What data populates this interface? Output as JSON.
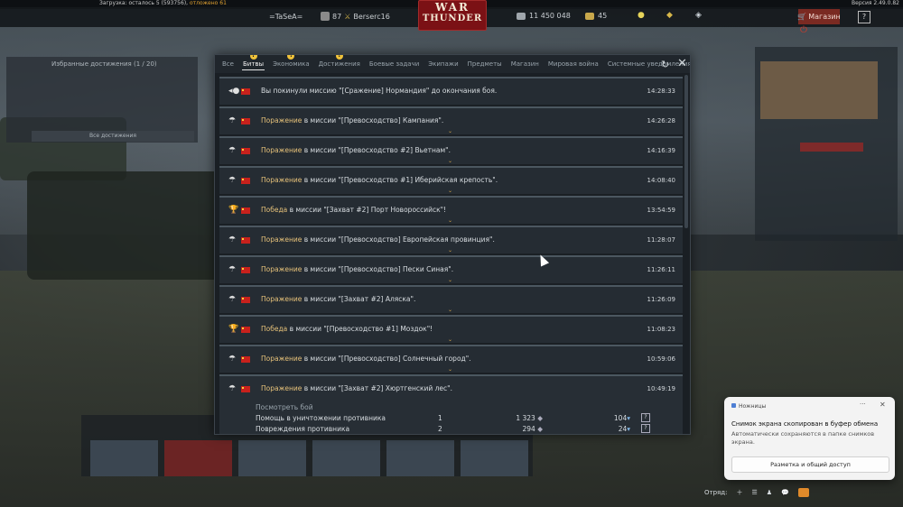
{
  "topbar": {
    "load_label": "Загрузка: осталось 5 (593756),",
    "load_warn": "отложено 61",
    "version": "Версия 2.49.0.82"
  },
  "header": {
    "clan": "=TaSeA=",
    "player_level": "87",
    "player_name": "Berserc16",
    "logo_line1": "WAR",
    "logo_line2": "THUNDER",
    "silver": "11 450 048",
    "gold": "45",
    "shop_label": "Магазин",
    "help_label": "?"
  },
  "bg_panels": {
    "left_title": "Избранные достижения (1 / 20)",
    "left_button": "Все достижения"
  },
  "notifications": {
    "tabs": [
      {
        "label": "Все",
        "badge": ""
      },
      {
        "label": "Битвы",
        "badge": "!"
      },
      {
        "label": "Экономика",
        "badge": "!"
      },
      {
        "label": "Достижения",
        "badge": "!"
      },
      {
        "label": "Боевые задачи",
        "badge": ""
      },
      {
        "label": "Экипажи",
        "badge": ""
      },
      {
        "label": "Предметы",
        "badge": ""
      },
      {
        "label": "Магазин",
        "badge": ""
      },
      {
        "label": "Мировая война",
        "badge": ""
      },
      {
        "label": "Системные уведомления",
        "badge": ""
      }
    ],
    "active_tab": "Битвы",
    "rows": [
      {
        "icon": "leave-icon",
        "result": "",
        "text": "Вы покинули миссию \"[Сражение] Нормандия\" до окончания боя.",
        "time": "14:28:33"
      },
      {
        "icon": "parachute-icon",
        "result": "Поражение",
        "text": " в миссии \"[Превосходство] Кампания\".",
        "time": "14:26:28"
      },
      {
        "icon": "parachute-icon",
        "result": "Поражение",
        "text": " в миссии \"[Превосходство #2] Вьетнам\".",
        "time": "14:16:39"
      },
      {
        "icon": "parachute-icon",
        "result": "Поражение",
        "text": " в миссии \"[Превосходство #1] Иберийская крепость\".",
        "time": "14:08:40"
      },
      {
        "icon": "trophy-icon",
        "result": "Победа",
        "text": " в миссии \"[Захват #2] Порт Новороссийск\"!",
        "time": "13:54:59"
      },
      {
        "icon": "parachute-icon",
        "result": "Поражение",
        "text": " в миссии \"[Превосходство] Европейская провинция\".",
        "time": "11:28:07"
      },
      {
        "icon": "parachute-icon",
        "result": "Поражение",
        "text": " в миссии \"[Превосходство] Пески Синая\".",
        "time": "11:26:11"
      },
      {
        "icon": "parachute-icon",
        "result": "Поражение",
        "text": " в миссии \"[Захват #2] Аляска\".",
        "time": "11:26:09"
      },
      {
        "icon": "trophy-icon",
        "result": "Победа",
        "text": " в миссии \"[Превосходство #1] Моздок\"!",
        "time": "11:08:23"
      },
      {
        "icon": "parachute-icon",
        "result": "Поражение",
        "text": " в миссии \"[Превосходство] Солнечный город\".",
        "time": "10:59:06"
      },
      {
        "icon": "parachute-icon",
        "result": "Поражение",
        "text": " в миссии \"[Захват #2] Хюртгенский лес\".",
        "time": "10:49:19"
      }
    ],
    "expanded": {
      "view_label": "Посмотреть бой",
      "stats": [
        {
          "label": "Помощь в уничтожении противника",
          "count": "1",
          "silver": "1 323",
          "rp": "104"
        },
        {
          "label": "Повреждения противника",
          "count": "2",
          "silver": "294",
          "rp": "24"
        }
      ]
    }
  },
  "toast": {
    "app": "Ножницы",
    "more": "···",
    "close": "✕",
    "title": "Снимок экрана скопирован в буфер обмена",
    "desc": "Автоматически сохраняются в папке снимков экрана.",
    "button": "Разметка и общий доступ"
  },
  "bottom": {
    "squad_label": "Отряд:"
  },
  "colors": {
    "accent_result": "#e7c27a",
    "window_bg": "#1a1f24",
    "row_bg": "#252c33",
    "shop": "#7a2a22",
    "flag": "#c8211c"
  }
}
